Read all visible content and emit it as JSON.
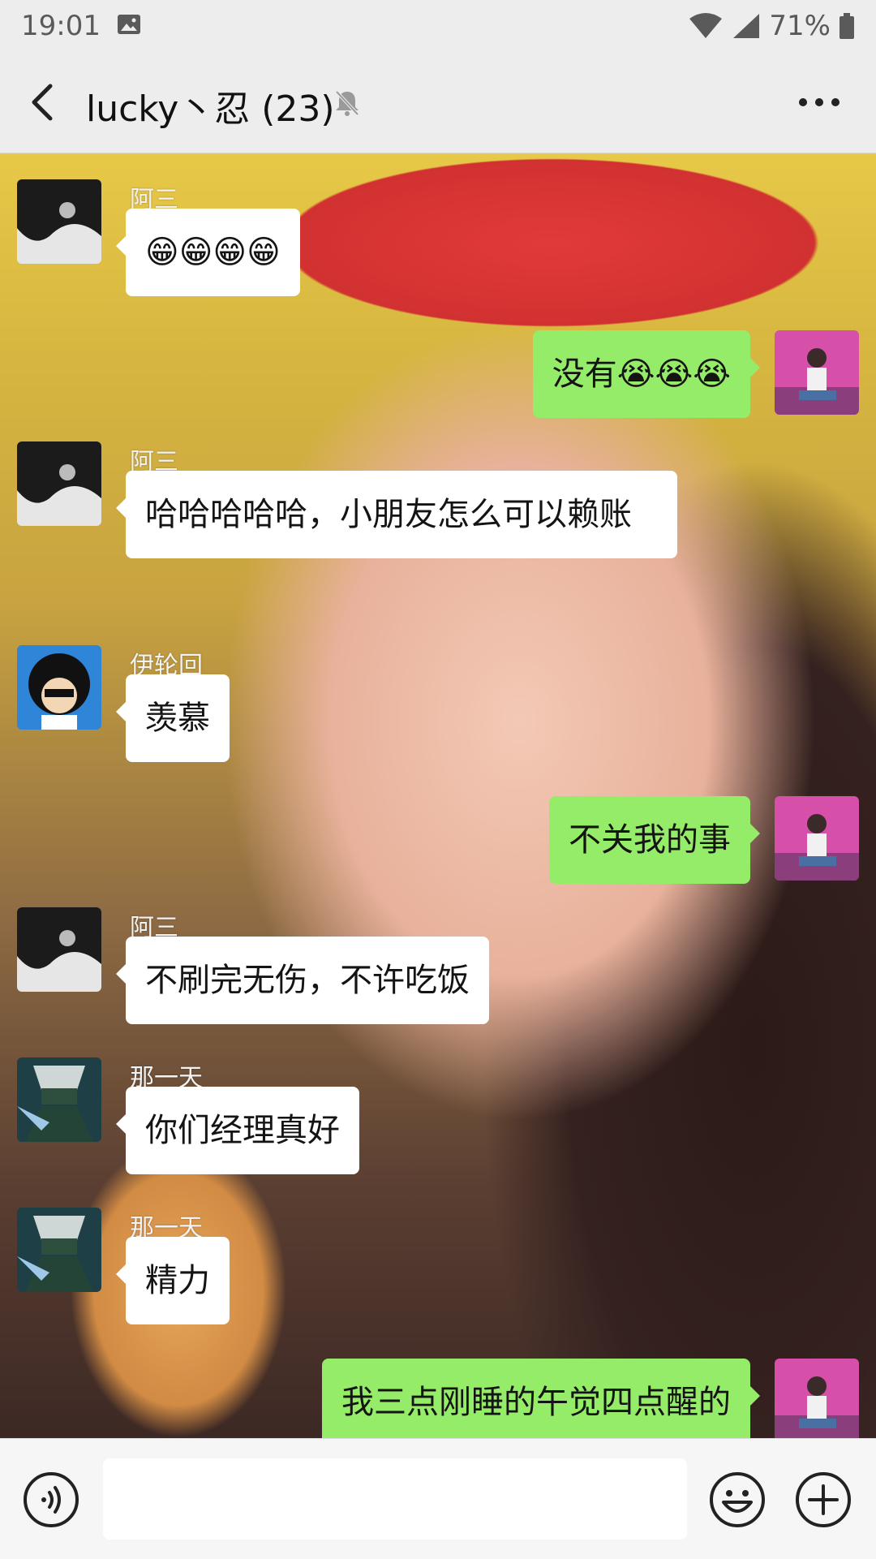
{
  "status_bar": {
    "time": "19:01",
    "battery": "71%"
  },
  "header": {
    "title": "lucky丶忍 (23)"
  },
  "messages": [
    {
      "side": "left",
      "sender": "阿三",
      "text": "😁😁😁😁"
    },
    {
      "side": "right",
      "sender": "",
      "text": "没有😭😭😭"
    },
    {
      "side": "left",
      "sender": "阿三",
      "text": "哈哈哈哈哈，小朋友怎么可以赖账"
    },
    {
      "side": "left",
      "sender": "伊轮回",
      "text": "羡慕"
    },
    {
      "side": "right",
      "sender": "",
      "text": "不关我的事"
    },
    {
      "side": "left",
      "sender": "阿三",
      "text": "不刷完无伤，不许吃饭"
    },
    {
      "side": "left",
      "sender": "那一天",
      "text": "你们经理真好"
    },
    {
      "side": "left",
      "sender": "那一天",
      "text": "精力"
    },
    {
      "side": "right",
      "sender": "",
      "text": "我三点刚睡的午觉四点醒的"
    }
  ],
  "input": {
    "value": ""
  },
  "icons": {
    "back": "back-arrow-icon",
    "mute": "mute-bell-icon",
    "more": "more-dots-icon",
    "voice": "voice-icon",
    "emoji": "emoji-icon",
    "plus": "plus-icon"
  },
  "colors": {
    "self_bubble": "#95ec69",
    "other_bubble": "#ffffff",
    "bar_bg": "#ededed"
  }
}
